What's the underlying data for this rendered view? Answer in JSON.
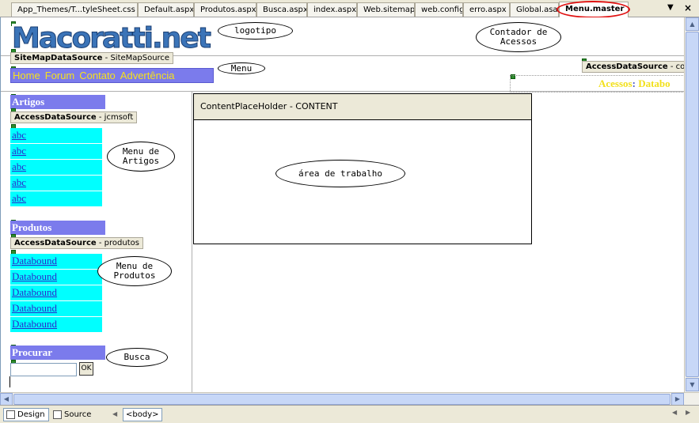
{
  "tabs": [
    {
      "label": "App_Themes/T...tyleSheet.css",
      "active": false
    },
    {
      "label": "Default.aspx",
      "active": false
    },
    {
      "label": "Produtos.aspx",
      "active": false
    },
    {
      "label": "Busca.aspx",
      "active": false
    },
    {
      "label": "index.aspx",
      "active": false
    },
    {
      "label": "Web.sitemap",
      "active": false
    },
    {
      "label": "web.config",
      "active": false
    },
    {
      "label": "erro.aspx",
      "active": false
    },
    {
      "label": "Global.asax",
      "active": false
    },
    {
      "label": "Menu.master",
      "active": true
    }
  ],
  "tab_controls": {
    "menu": "▼",
    "close": "×"
  },
  "logo": {
    "text": "Macoratti.net"
  },
  "notes": {
    "logotipo": "logotipo",
    "contador": "Contador de\nAcessos",
    "menu": "Menu",
    "menu_artigos": "Menu de\nArtigos",
    "area_trabalho": "área de trabalho",
    "menu_produtos": "Menu de\nProdutos",
    "busca": "Busca"
  },
  "datasources": {
    "sitemap": {
      "type": "SiteMapDataSource",
      "id": "SiteMapSource"
    },
    "contador": {
      "type": "AccessDataSource",
      "id": "conta"
    },
    "artigos": {
      "type": "AccessDataSource",
      "id": "jcmsoft"
    },
    "produtos": {
      "type": "AccessDataSource",
      "id": "produtos"
    }
  },
  "menu_items": [
    "Home",
    "Forum",
    "Contato",
    "Advertência"
  ],
  "counter": {
    "label": "Acessos",
    "separator": ":",
    "value": "Databo"
  },
  "artigos": {
    "header": "Artigos",
    "items": [
      "abc",
      "abc",
      "abc",
      "abc",
      "abc"
    ]
  },
  "produtos": {
    "header": "Produtos",
    "items": [
      "Databound",
      "Databound",
      "Databound",
      "Databound",
      "Databound"
    ]
  },
  "search": {
    "header": "Procurar",
    "input_value": "",
    "button_label": "OK"
  },
  "content_placeholder": {
    "type": "ContentPlaceHolder",
    "id": "CONTENT"
  },
  "scrollbar_glyphs": {
    "up": "▲",
    "down": "▼",
    "left": "◀",
    "right": "▶"
  },
  "viewbar": {
    "design": "Design",
    "source": "Source",
    "breadcrumb": "<body>",
    "nav_left": "◀",
    "nav_right": "▶"
  },
  "colors": {
    "menu_bg": "#7b7bec",
    "menu_text": "#f7e11b",
    "list_bg": "#00ffff",
    "link": "#2b2bcc",
    "highlight_ring": "#e01010"
  }
}
